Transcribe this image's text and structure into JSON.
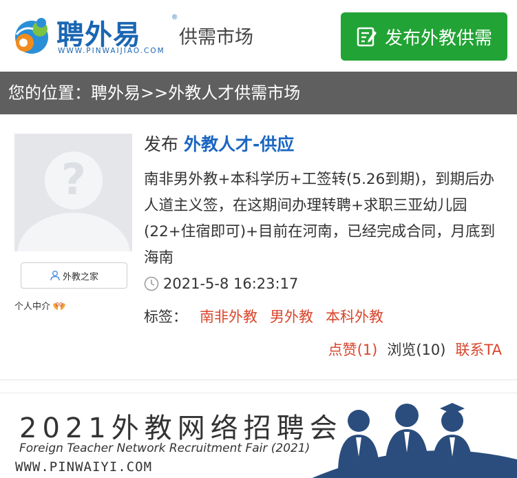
{
  "header": {
    "logo_name": "聘外易",
    "logo_reg": "®",
    "logo_sub": "供需市场",
    "logo_url": "WWW.PINWAIJIAO.COM",
    "publish_label": "发布外教供需",
    "brand_blue": "#1a66b3",
    "publish_green": "#22a335"
  },
  "breadcrumb": {
    "prefix": "您的位置：",
    "home": "聘外易",
    "sep": ">>",
    "current": "外教人才供需市场"
  },
  "post": {
    "title_prefix": "发布",
    "category": "外教人才-供应",
    "description": "南非男外教+本科学历+工签转(5.26到期)，到期后办人道主义签，在这期间办理转聘+求职三亚幼儿园(22+住宿即可)+目前在河南，已经完成合同，月底到海南",
    "datetime": "2021-5-8 16:23:17",
    "tags_label": "标签：",
    "tags": [
      "南非外教",
      "男外教",
      "本科外教"
    ],
    "like_label": "点赞",
    "like_count": "(1)",
    "view_label": "浏览",
    "view_count": "(10)",
    "contact_label": "联系TA",
    "author": {
      "home_label": "外教之家",
      "intro_label": "个人中介",
      "intro_badge": "00"
    }
  },
  "banner": {
    "title": "2021外教网络招聘会",
    "subtitle": "Foreign Teacher Network Recruitment Fair (2021)",
    "url": "WWW.PINWAIYI.COM"
  }
}
